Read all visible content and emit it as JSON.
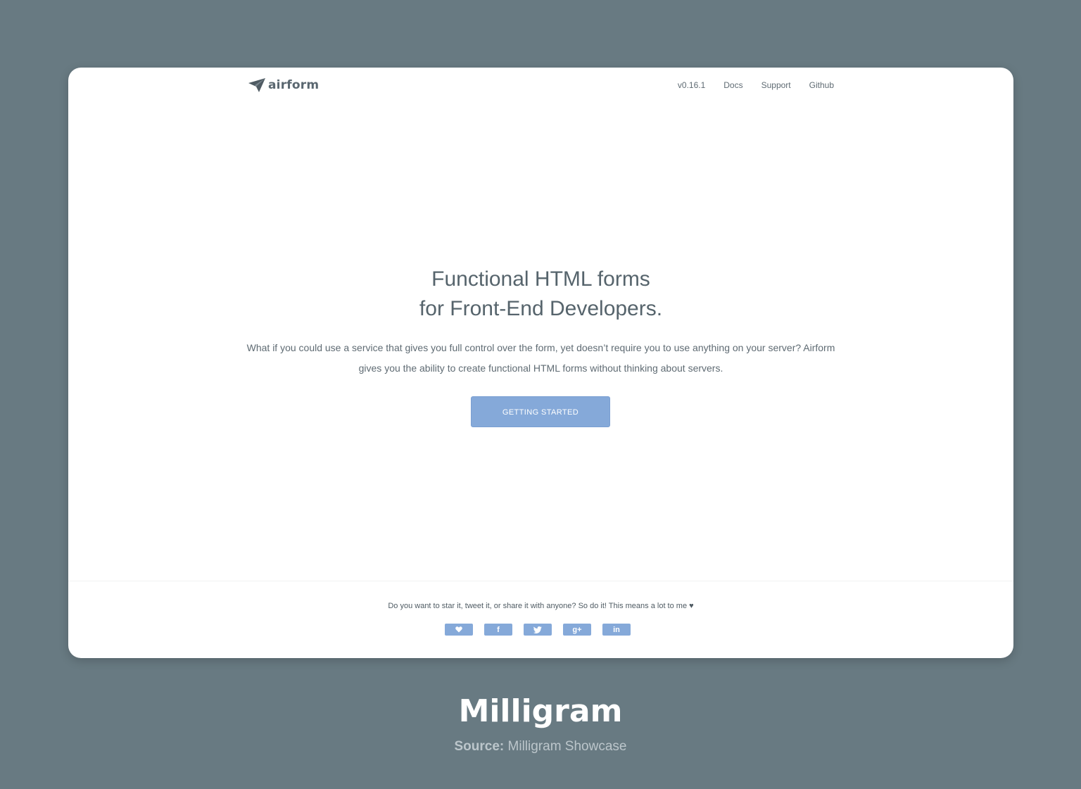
{
  "header": {
    "logo_text": "airform",
    "nav": [
      {
        "label": "v0.16.1"
      },
      {
        "label": "Docs"
      },
      {
        "label": "Support"
      },
      {
        "label": "Github"
      }
    ]
  },
  "hero": {
    "title_line1": "Functional HTML forms",
    "title_line2": "for Front-End Developers.",
    "description": "What if you could use a service that gives you full control over the form, yet doesn’t require you to use anything on your server? Airform gives you the ability to create functional HTML forms without thinking about servers.",
    "cta_label": "GETTING STARTED"
  },
  "footer": {
    "share_text": "Do you want to star it, tweet it, or share it with anyone? So do it! This means a lot to me ♥",
    "share_buttons": [
      {
        "icon": "heart-icon"
      },
      {
        "icon": "facebook-icon",
        "glyph": "f"
      },
      {
        "icon": "twitter-icon"
      },
      {
        "icon": "google-plus-icon",
        "glyph": "g+"
      },
      {
        "icon": "linkedin-icon",
        "glyph": "in"
      }
    ]
  },
  "caption": {
    "title": "Milligram",
    "source_label": "Source:",
    "source_value": "Milligram Showcase"
  },
  "colors": {
    "background": "#687a82",
    "accent": "#85a9d9",
    "text": "#56646c"
  }
}
